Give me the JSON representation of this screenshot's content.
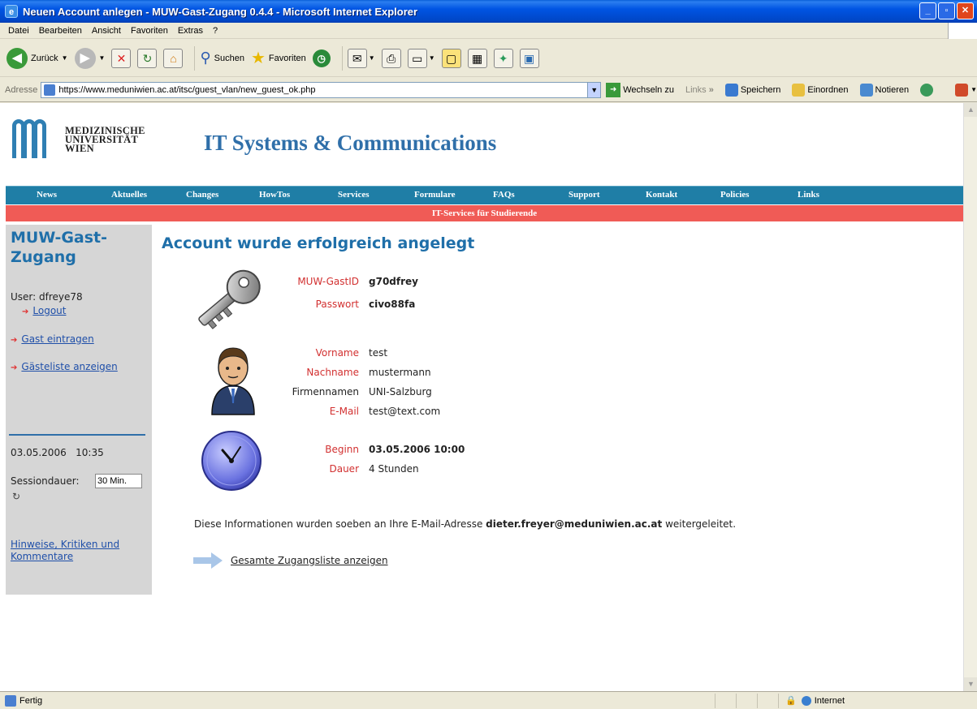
{
  "window": {
    "title": "Neuen Account anlegen - MUW-Gast-Zugang 0.4.4 - Microsoft Internet Explorer",
    "buttons": [
      "_",
      "▫",
      "✕"
    ]
  },
  "menu": [
    "Datei",
    "Bearbeiten",
    "Ansicht",
    "Favoriten",
    "Extras",
    "?"
  ],
  "toolbar": {
    "back": "Zurück",
    "search": "Suchen",
    "favorites": "Favoriten"
  },
  "address": {
    "label": "Adresse",
    "url": "https://www.meduniwien.ac.at/itsc/guest_vlan/new_guest_ok.php",
    "go": "Wechseln zu",
    "links": "Links",
    "links_more": "»",
    "save": "Speichern",
    "sort": "Einordnen",
    "notes": "Notieren"
  },
  "site": {
    "logo_line1": "MEDIZINISCHE",
    "logo_line2": "UNIVERSITÄT",
    "logo_line3": "WIEN",
    "title": "IT Systems & Communications"
  },
  "nav": [
    "News",
    "Aktuelles",
    "Changes",
    "HowTos",
    "Services",
    "Formulare",
    "FAQs",
    "Support",
    "Kontakt",
    "Policies",
    "Links"
  ],
  "subnav": "IT-Services für Studierende",
  "sidebar": {
    "title_line1": "MUW-Gast-",
    "title_line2": "Zugang",
    "user": "User: dfreye78",
    "logout": "Logout",
    "add_guest": "Gast eintragen",
    "guest_list": "Gästeliste anzeigen",
    "datetime": "03.05.2006   10:35",
    "session_label": "Sessiondauer:",
    "session_value": "30 Min.",
    "feedback_line1": "Hinweise, Kritiken und",
    "feedback_line2": "Kommentare"
  },
  "main": {
    "heading": "Account wurde erfolgreich angelegt",
    "account": {
      "id_label": "MUW-GastID",
      "id_value": "g70dfrey",
      "pw_label": "Passwort",
      "pw_value": "civo88fa"
    },
    "person": {
      "first_label": "Vorname",
      "first_value": "test",
      "last_label": "Nachname",
      "last_value": "mustermann",
      "company_label": "Firmennamen",
      "company_value": "UNI-Salzburg",
      "email_label": "E-Mail",
      "email_value": "test@text.com"
    },
    "time": {
      "start_label": "Beginn",
      "start_value": "03.05.2006 10:00",
      "duration_label": "Dauer",
      "duration_value": "4 Stunden"
    },
    "info_pre": "Diese Informationen wurden soeben an Ihre E-Mail-Adresse ",
    "info_email": "dieter.freyer@meduniwien.ac.at",
    "info_post": " weitergeleitet.",
    "list_link": "Gesamte Zugangsliste anzeigen"
  },
  "status": {
    "done": "Fertig",
    "zone": "Internet"
  },
  "colors": {
    "brand_blue": "#1f6fa9",
    "nav_bg": "#1f7ea6",
    "subnav_bg": "#f05b56",
    "label_red": "#d23030"
  }
}
